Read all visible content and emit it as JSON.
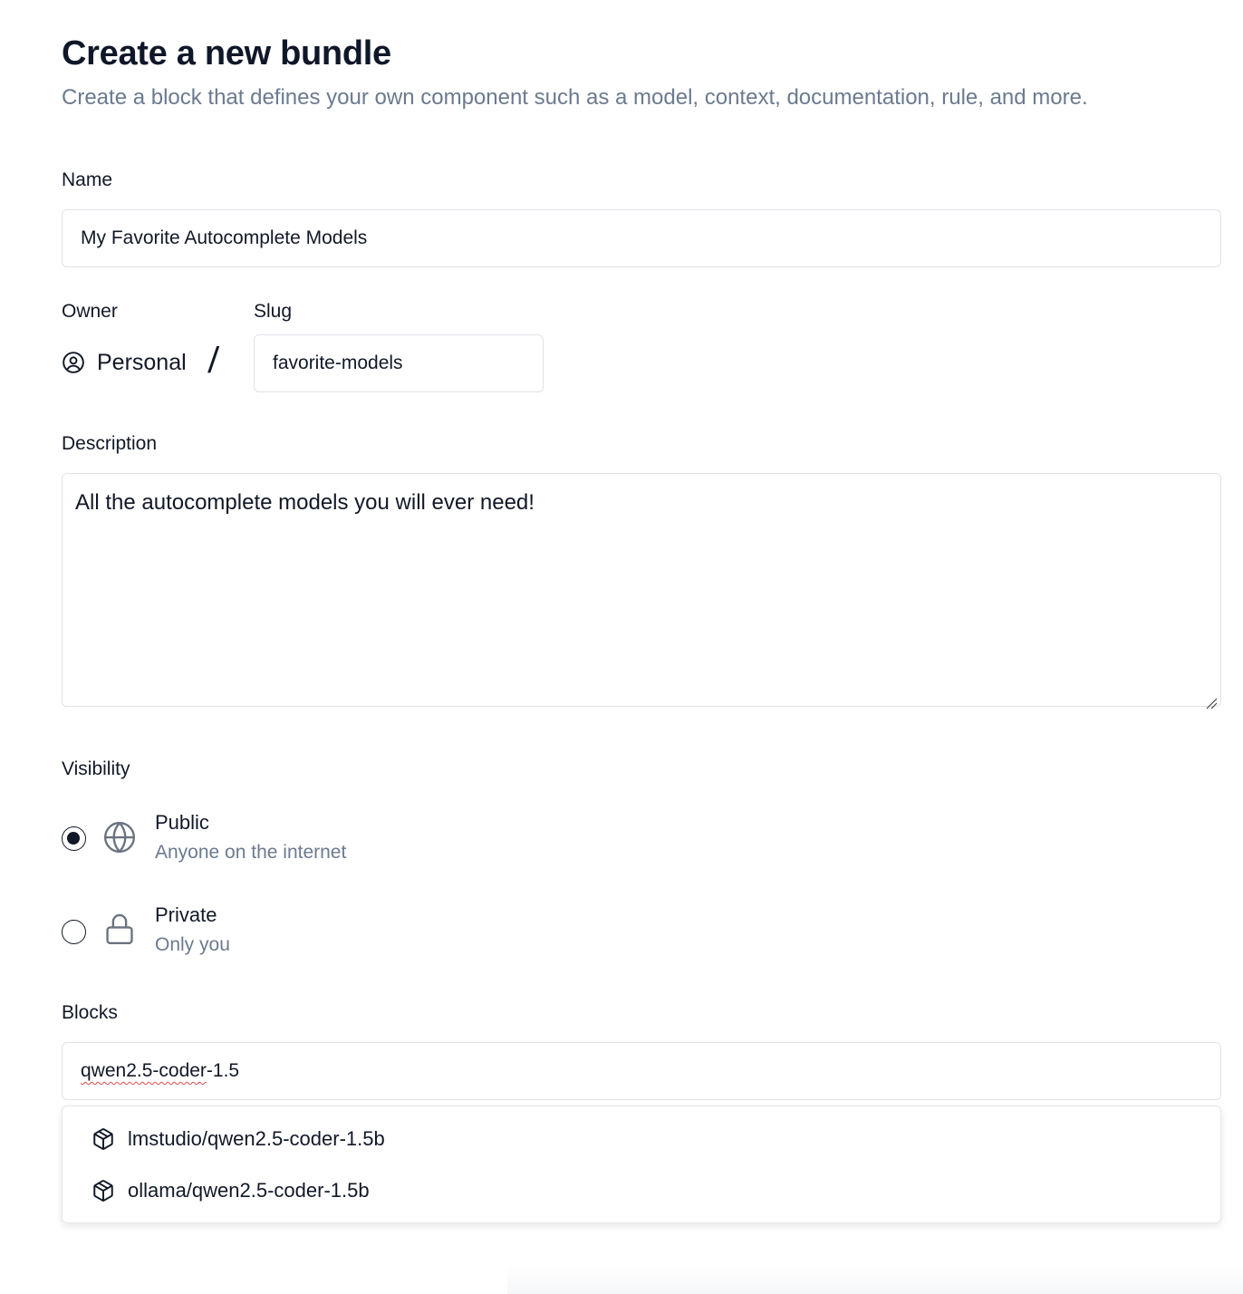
{
  "header": {
    "title": "Create a new bundle",
    "subtitle": "Create a block that defines your own component such as a model, context, documentation, rule, and more."
  },
  "form": {
    "name": {
      "label": "Name",
      "value": "My Favorite Autocomplete Models"
    },
    "owner": {
      "label": "Owner",
      "value": "Personal",
      "icon": "user-circle-icon",
      "separator": "/"
    },
    "slug": {
      "label": "Slug",
      "value": "favorite-models"
    },
    "description": {
      "label": "Description",
      "value": "All the autocomplete models you will ever need!"
    },
    "visibility": {
      "label": "Visibility",
      "selected": "Public",
      "options": [
        {
          "title": "Public",
          "description": "Anyone on the internet",
          "icon": "globe-icon",
          "checked": true
        },
        {
          "title": "Private",
          "description": "Only you",
          "icon": "lock-icon",
          "checked": false
        }
      ]
    },
    "blocks": {
      "label": "Blocks",
      "query_underlined": "qwen2.5-coder",
      "query_rest": "-1.5",
      "suggestions": [
        {
          "label": "lmstudio/qwen2.5-coder-1.5b",
          "icon": "cube-icon"
        },
        {
          "label": "ollama/qwen2.5-coder-1.5b",
          "icon": "cube-icon"
        }
      ]
    }
  },
  "colors": {
    "text_primary": "#111827",
    "text_muted": "#6b7a90",
    "border": "#dfe3e8",
    "icon_gray": "#6b7280",
    "spellcheck": "#e24b4b"
  }
}
